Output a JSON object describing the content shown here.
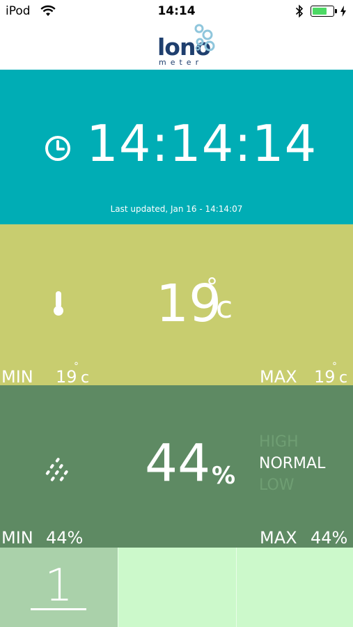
{
  "status_bar": {
    "carrier": "iPod",
    "time": "14:14",
    "battery_percent": 75,
    "battery_color": "#4cd964"
  },
  "header": {
    "logo_word": "lono",
    "logo_sub": "meter",
    "logo_icon": "bubbles-icon"
  },
  "time_panel": {
    "color": "#00adb5",
    "icon": "clock-icon",
    "time": "14:14:14",
    "last_updated": "Last updated, Jan 16 - 14:14:07"
  },
  "temperature_panel": {
    "color": "#c8cd6f",
    "icon": "thermometer-icon",
    "value": "19",
    "degree": "°",
    "unit": "c",
    "min_label": "MIN",
    "min_value": "19",
    "max_label": "MAX",
    "max_value": "19"
  },
  "humidity_panel": {
    "color": "#5e8a63",
    "icon": "raindrops-icon",
    "value": "44",
    "unit": "%",
    "levels": {
      "high": "HIGH",
      "normal": "NORMAL",
      "low": "LOW",
      "active": "NORMAL"
    },
    "min_label": "MIN",
    "min_value": "44%",
    "max_label": "MAX",
    "max_value": "44%"
  },
  "tab_bar": {
    "tabs": [
      {
        "label": "1",
        "selected": true
      },
      {
        "label": "",
        "selected": false
      },
      {
        "label": "",
        "selected": false
      }
    ]
  }
}
